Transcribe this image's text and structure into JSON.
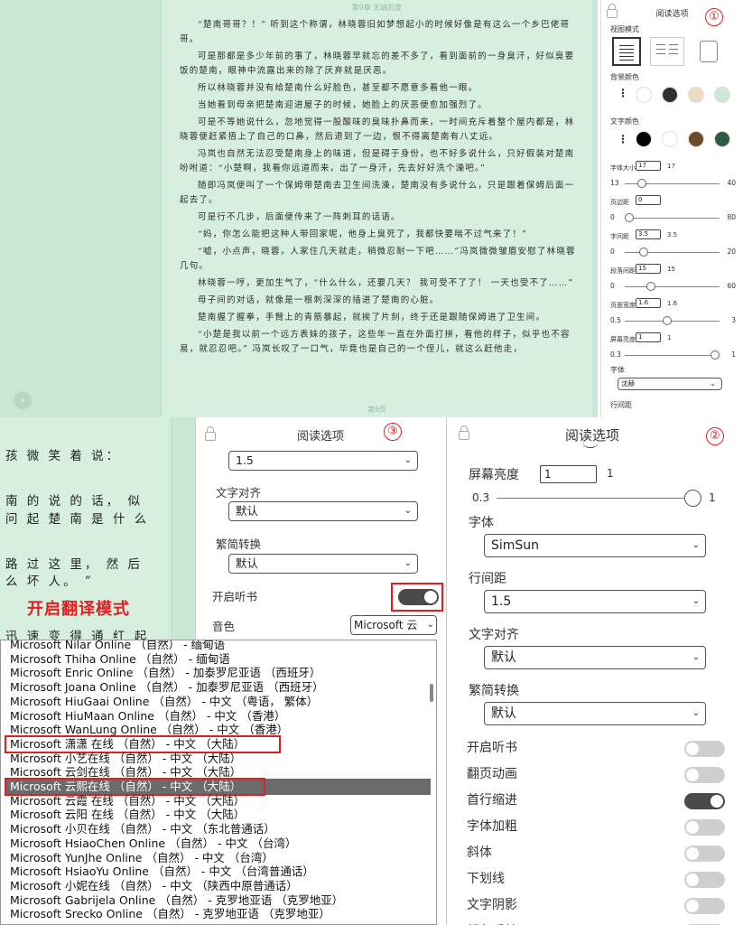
{
  "reader_top": {
    "chapter_header": "第9章 无端的爱",
    "page_footer": "第9页",
    "paragraphs": [
      "“楚南哥哥？！” 听到这个称谓，林晓蓉旧如梦想起小的时候好像是有这么一个乡巴佬哥哥。",
      "可是那都是多少年前的事了，林晓蓉早就忘的差不多了，看到面前的一身臭汗，好似臭要饭的楚南，眼神中流露出来的除了厌弃就是厌恶。",
      "所以林晓蓉并没有给楚南什么好脸色，甚至都不愿意多看他一眼。",
      "当她看到母亲把楚南迎进屋子的时候，她脸上的厌恶便愈加强烈了。",
      "可是不等她说什么，忽地觉得一股酸味的臭味扑鼻而来，一时间充斥着整个屋内都是，林晓蓉便赶紧捂上了自己的口鼻，然后退到了一边，恨不得离楚南有八丈远。",
      "冯岚也自然无法忍受楚南身上的味道，但是碍于身份，也不好多说什么，只好假装对楚南吩咐道：“小楚啊，我看你远道而来，出了一身汗，先去好好洗个澡吧。”",
      "随即冯岚便叫了一个保姆带楚南去卫生间洗澡，楚南没有多说什么，只是跟着保姆后面一起去了。",
      "可是行不几步，后面便传来了一阵刺耳的话语。",
      "“妈，你怎么能把这种人带回家呢，他身上臭死了，我都快要喘不过气来了！”",
      "“嘘，小点声，晓蓉，人家住几天就走，稍微忍耐一下吧……”冯岚微微皱眉安慰了林晓蓉几句。",
      "林晓蓉一哼，更加生气了，“什么什么，还要几天？ 我可受不了了！ 一天也受不了……”",
      "母子间的对话，就像是一根刺深深的插进了楚南的心脏。",
      "楚南握了握拳，手臂上的青筋暴起，就挨了片刻，终于还是跟随保姆进了卫生间。",
      "“小楚是我以前一个远方表妹的孩子，这些年一直在外面打拼，看他的样子，似乎也不容易，就忍忍吧。” 冯岚长叹了一口气，毕竟也是自己的一个侄儿，就这么赶他走，"
    ]
  },
  "panel1": {
    "title": "阅读选项",
    "badge": "①",
    "view_mode_label": "视图模式",
    "bg_color_label": "背景颜色",
    "text_color_label": "文字颜色",
    "bg_colors": [
      "#ffffff",
      "#2d3033",
      "#ecdcc1",
      "#cfe8d3"
    ],
    "text_colors": [
      "#000000",
      "#ffffff",
      "#6b4a2a",
      "#2f5a40"
    ],
    "font_size": {
      "label": "字体大小",
      "value": "17",
      "display": "17",
      "min": "13",
      "max": "40"
    },
    "margin": {
      "label": "页边距",
      "value": "0",
      "display": "",
      "min": "0",
      "max": "80"
    },
    "letter_spacing": {
      "label": "字间距",
      "value": "3.5",
      "display": "3.5",
      "min": "0",
      "max": "20"
    },
    "para_spacing": {
      "label": "段落间距",
      "value": "15",
      "display": "15",
      "min": "0",
      "max": "60"
    },
    "page_width": {
      "label": "页面宽度",
      "value": "1.6",
      "display": "1.6",
      "min": "0.5",
      "max": "3"
    },
    "brightness": {
      "label": "屏幕亮度",
      "value": "1",
      "display": "1",
      "min": "0.3",
      "max": "1"
    },
    "font_label": "字体",
    "font_value": "沈赫",
    "line_spacing_label": "行间距"
  },
  "reader_left": {
    "lines": [
      "孩 微 笑 着 说：",
      "南 的 说 的 话， 似",
      "问 起 楚 南 是 什 么",
      "路 过 这 里， 然 后",
      "么 坏 人。 ”",
      "迅 速 变 得 通 红 起"
    ],
    "translate_label": "开启翻译模式"
  },
  "panel3": {
    "title": "阅读选项",
    "badge": "③",
    "line_spacing_value": "1.5",
    "align_label": "文字对齐",
    "align_value": "默认",
    "convert_label": "繁简转换",
    "convert_value": "默认",
    "tts_label": "开启听书",
    "voice_label": "音色",
    "voice_value": "Microsoft 云"
  },
  "voice_list": {
    "items": [
      "Microsoft Nilar Online （自然） - 缅甸语",
      "Microsoft Thiha Online （自然） - 缅甸语",
      "Microsoft Enric Online （自然） - 加泰罗尼亚语 （西班牙）",
      "Microsoft Joana Online （自然） - 加泰罗尼亚语 （西班牙）",
      "Microsoft HiuGaai Online （自然） - 中文 （粤语， 繁体）",
      "Microsoft HiuMaan Online （自然） - 中文 （香港）",
      "Microsoft WanLung Online （自然） - 中文 （香港）",
      "Microsoft 潇潇 在线 （自然） - 中文 （大陆）",
      "Microsoft 小艺在线 （自然） - 中文 （大陆）",
      "Microsoft 云剑在线 （自然） - 中文 （大陆）",
      "Microsoft 云熙在线 （自然） - 中文 （大陆）",
      "Microsoft 云霞 在线 （自然） - 中文 （大陆）",
      "Microsoft 云阳 在线 （自然） - 中文 （大陆）",
      "Microsoft 小贝在线 （自然） - 中文 （东北普通话）",
      "Microsoft HsiaoChen Online （自然） - 中文 （台湾）",
      "Microsoft YunJhe Online （自然） - 中文 （台湾）",
      "Microsoft HsiaoYu Online （自然） - 中文 （台湾普通话）",
      "Microsoft 小妮在线 （自然） - 中文 （陕西中原普通话）",
      "Microsoft Gabrijela Online （自然） - 克罗地亚语 （克罗地亚）",
      "Microsoft Srecko Online （自然） - 克罗地亚语 （克罗地亚）"
    ],
    "selected_index": 10,
    "boxed_index": 7
  },
  "panel2": {
    "title": "阅读选项",
    "badge": "②",
    "brightness_label": "屏幕亮度",
    "brightness_value": "1",
    "brightness_display": "1",
    "brightness_min": "0.3",
    "brightness_max": "1",
    "font_label": "字体",
    "font_value": "SimSun",
    "line_spacing_label": "行间距",
    "line_spacing_value": "1.5",
    "align_label": "文字对齐",
    "align_value": "默认",
    "convert_label": "繁简转换",
    "convert_value": "默认",
    "toggles": [
      {
        "label": "开启听书",
        "on": false
      },
      {
        "label": "翻页动画",
        "on": false
      },
      {
        "label": "首行缩进",
        "on": true
      },
      {
        "label": "字体加粗",
        "on": false
      },
      {
        "label": "斜体",
        "on": false
      },
      {
        "label": "下划线",
        "on": false
      },
      {
        "label": "文字阴影",
        "on": false
      },
      {
        "label": "颜色反转",
        "on": false
      }
    ]
  },
  "icons": {
    "chevron": "⌄",
    "prev": "‹",
    "dots": "⋮"
  }
}
